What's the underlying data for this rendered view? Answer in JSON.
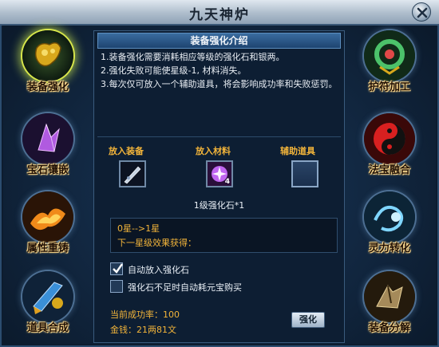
{
  "window": {
    "title": "九天神炉"
  },
  "left_slots": [
    {
      "label": "装备强化",
      "icon": "armor-strengthen-icon",
      "active": true
    },
    {
      "label": "宝石镶嵌",
      "icon": "gem-inlay-icon",
      "active": false
    },
    {
      "label": "属性重铸",
      "icon": "attribute-recast-icon",
      "active": false
    },
    {
      "label": "道具合成",
      "icon": "item-synthesis-icon",
      "active": false
    }
  ],
  "right_slots": [
    {
      "label": "护符加工",
      "icon": "talisman-processing-icon"
    },
    {
      "label": "法宝融合",
      "icon": "magic-treasure-fusion-icon"
    },
    {
      "label": "灵力转化",
      "icon": "spirit-conversion-icon"
    },
    {
      "label": "装备分解",
      "icon": "equipment-decompose-icon"
    }
  ],
  "panel": {
    "header": "装备强化介绍",
    "intro": [
      "1.装备强化需要消耗相应等级的强化石和银两。",
      "2.强化失败可能使星级-1, 材料消失。",
      "3.每次仅可放入一个辅助道具，将会影响成功率和失败惩罚。"
    ],
    "put_equipment": "放入装备",
    "put_material": "放入材料",
    "aux_item": "辅助道具",
    "material_qty": "4",
    "material_name": "1级强化石*1",
    "star_change": "0星-->1星",
    "next_effect": "下一星级效果获得：",
    "auto_put_label": "自动放入强化石",
    "auto_put_checked": true,
    "auto_buy_label": "强化石不足时自动耗元宝购买",
    "auto_buy_checked": false,
    "success_rate": "当前成功率：100",
    "money": "金钱：21两81文",
    "strengthen_button": "强化"
  },
  "colors": {
    "accent_gold": "#f2b43a",
    "panel_bg": "#0d1e33"
  }
}
